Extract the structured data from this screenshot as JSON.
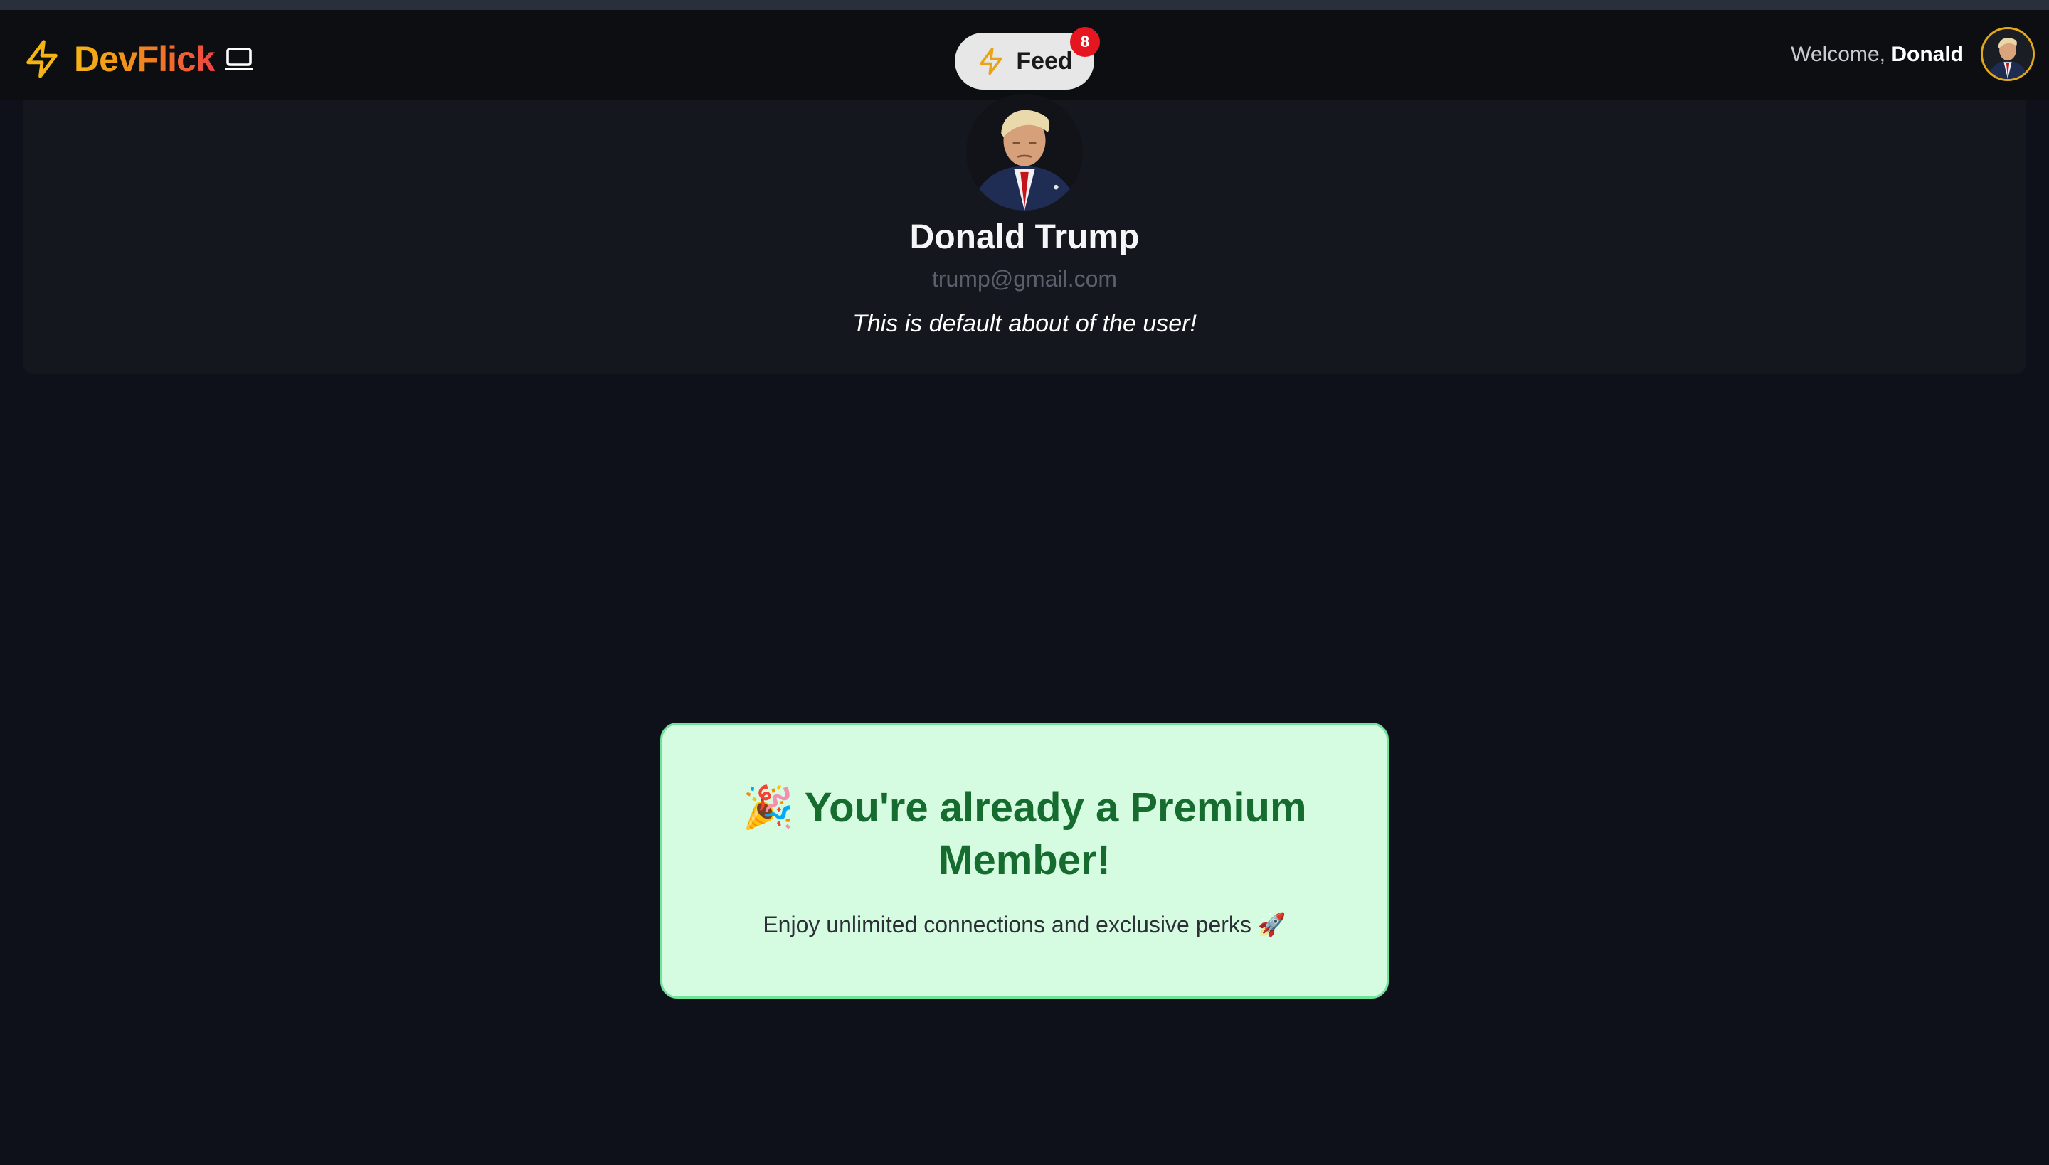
{
  "nav": {
    "brand": "DevFlick",
    "feed_label": "Feed",
    "feed_badge": "8",
    "welcome_prefix": "Welcome,",
    "welcome_name": "Donald"
  },
  "profile": {
    "name": "Donald Trump",
    "email": "trump@gmail.com",
    "about": "This is default about of the user!"
  },
  "premium": {
    "title": "🎉 You're already a Premium Member!",
    "subtitle": "Enjoy unlimited connections and exclusive perks 🚀"
  },
  "colors": {
    "background": "#0e111a",
    "brand_gradient_start": "#f5b416",
    "brand_gradient_end": "#ef4444",
    "badge": "#e5161f",
    "premium_bg": "#d5fbe1",
    "premium_text": "#166c2e"
  },
  "icons": {
    "brand_icon": "lightning-bolt",
    "brand_suffix_icon": "laptop",
    "feed_icon": "lightning-bolt"
  }
}
